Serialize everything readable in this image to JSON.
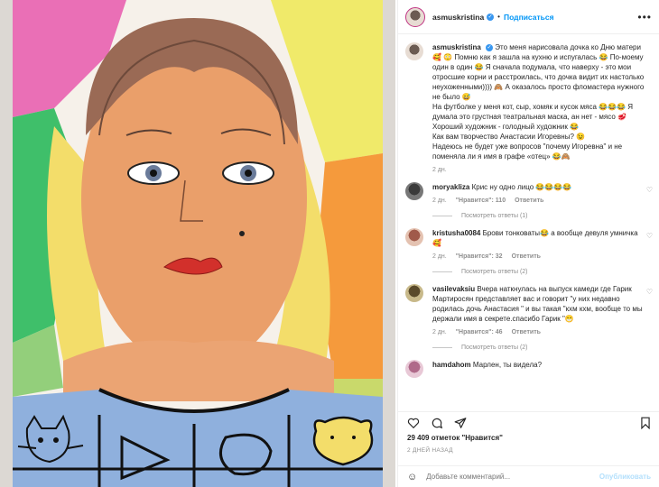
{
  "post": {
    "username": "asmuskristina",
    "follow_label": "Подписаться",
    "caption_lines": [
      "Это меня нарисовала дочка ко Дню матери 🥰",
      "😳 Помню как я зашла на кухню и испугалась 😂 По-моему один в один 😂 Я сначала подумала, что наверху - это мои отросшие корни и расстроилась, что дочка видит их настолько неухоженными)))) 🙈 А оказалось просто фломастера нужного не было 😅",
      "На футболке у меня кот, сыр, хомяк и кусок мяса 😂😂😂 Я думала это грустная театральная маска, ан нет - мясо 🥩",
      "Хороший художник - голодный художник 😂",
      "Как вам творчество Анастасии Игоревны? 😉",
      "Надеюсь не будет уже вопросов \"почему Игоревна\" и не поменяла ли я имя в графе «отец» 😂🙈"
    ],
    "caption_time": "2 дн."
  },
  "comments": [
    {
      "user": "moryakliza",
      "text": "Крис ну одно лицо 😂😂😂😂",
      "time": "2 дн.",
      "likes": "\"Нравится\": 110",
      "reply": "Ответить",
      "view_replies": "Посмотреть ответы (1)"
    },
    {
      "user": "kristusha0084",
      "text": "Брови тонковаты😂 а вообще девуля умничка 🥰",
      "time": "2 дн.",
      "likes": "\"Нравится\": 32",
      "reply": "Ответить",
      "view_replies": "Посмотреть ответы (2)"
    },
    {
      "user": "vasilevaksiu",
      "text": "Вчера наткнулась на выпуск камеди где Гарик Мартиросян представляет вас и говорит \"у них недавно родилась дочь Анастасия \" и вы такая \"кхм кхм, вообще то мы держали имя в секрете.спасибо Гарик \"😁",
      "time": "2 дн.",
      "likes": "\"Нравится\": 46",
      "reply": "Ответить",
      "view_replies": "Посмотреть ответы (2)"
    },
    {
      "user": "hamdahom",
      "text": "Марлен, ты видела?",
      "time": "",
      "likes": "",
      "reply": "",
      "view_replies": ""
    }
  ],
  "footer": {
    "likes": "29 409 отметок \"Нравится\"",
    "date": "2 ДНЕЙ НАЗАД",
    "add_comment_placeholder": "Добавьте комментарий...",
    "publish_label": "Опубликовать"
  },
  "icons": {
    "like": "heart-icon",
    "comment": "comment-icon",
    "share": "share-icon",
    "save": "bookmark-icon",
    "emoji": "smile-icon",
    "more": "more-icon"
  },
  "colors": {
    "link": "#0095f6",
    "muted": "#8e8e8e",
    "verified": "#3897f0"
  }
}
